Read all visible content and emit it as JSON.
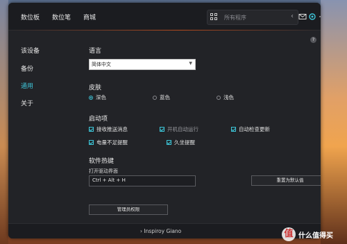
{
  "topbar": {
    "tabs": [
      "数位板",
      "数位笔",
      "商城"
    ],
    "search_placeholder": "所有程序",
    "search_arrow": "‹",
    "icons": [
      "grid-icon",
      "mail-icon",
      "settings-icon",
      "minimize-icon",
      "close-icon"
    ]
  },
  "sidebar": {
    "items": [
      {
        "label": "该设备",
        "active": false
      },
      {
        "label": "备份",
        "active": false
      },
      {
        "label": "通用",
        "active": true
      },
      {
        "label": "关于",
        "active": false
      }
    ]
  },
  "content": {
    "help": "?",
    "language": {
      "title": "语言",
      "value": "简体中文"
    },
    "skin": {
      "title": "皮肤",
      "options": [
        {
          "label": "深色",
          "checked": true
        },
        {
          "label": "蓝色",
          "checked": false
        },
        {
          "label": "浅色",
          "checked": false
        }
      ]
    },
    "startup": {
      "title": "启动项",
      "items": [
        {
          "label": "接收推送消息",
          "checked": true,
          "dim": false
        },
        {
          "label": "开机自动运行",
          "checked": true,
          "dim": true
        },
        {
          "label": "自动检查更新",
          "checked": true,
          "dim": false
        },
        {
          "label": "电量不足提醒",
          "checked": true,
          "dim": false
        },
        {
          "label": "久坐提醒",
          "checked": true,
          "dim": false
        }
      ]
    },
    "hotkey": {
      "title": "软件热键",
      "sub_label": "打开驱动界面",
      "value": "Ctrl + Alt + H",
      "reset_label": "重置为默认值"
    },
    "admin_label": "管理员权限"
  },
  "bottombar": {
    "label": "Inspiroy Giano",
    "chevron": "›"
  },
  "watermark": {
    "symbol": "值",
    "text": "什么值得买"
  },
  "colors": {
    "accent": "#3ec6d9",
    "window_bg": "#222327",
    "topbar_bg": "#1b1c20"
  }
}
